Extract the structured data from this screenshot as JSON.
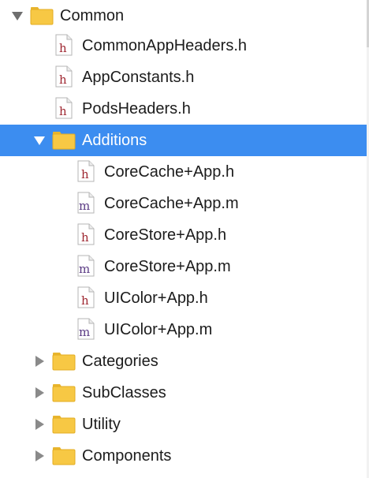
{
  "tree": {
    "rows": [
      {
        "label": "Common",
        "kind": "folder",
        "expanded": true
      },
      {
        "label": "CommonAppHeaders.h",
        "kind": "h"
      },
      {
        "label": "AppConstants.h",
        "kind": "h"
      },
      {
        "label": "PodsHeaders.h",
        "kind": "h"
      },
      {
        "label": "Additions",
        "kind": "folder",
        "expanded": true,
        "selected": true
      },
      {
        "label": "CoreCache+App.h",
        "kind": "h"
      },
      {
        "label": "CoreCache+App.m",
        "kind": "m"
      },
      {
        "label": "CoreStore+App.h",
        "kind": "h"
      },
      {
        "label": "CoreStore+App.m",
        "kind": "m"
      },
      {
        "label": "UIColor+App.h",
        "kind": "h"
      },
      {
        "label": "UIColor+App.m",
        "kind": "m"
      },
      {
        "label": "Categories",
        "kind": "folder",
        "expanded": false
      },
      {
        "label": "SubClasses",
        "kind": "folder",
        "expanded": false
      },
      {
        "label": "Utility",
        "kind": "folder",
        "expanded": false
      },
      {
        "label": "Components",
        "kind": "folder",
        "expanded": false
      }
    ],
    "icon_glyphs": {
      "h": "h",
      "m": "m"
    },
    "colors": {
      "selection": "#3c8df0",
      "folder": "#f7c844",
      "header_glyph": "#9e2630",
      "impl_glyph": "#5a3a84"
    }
  }
}
